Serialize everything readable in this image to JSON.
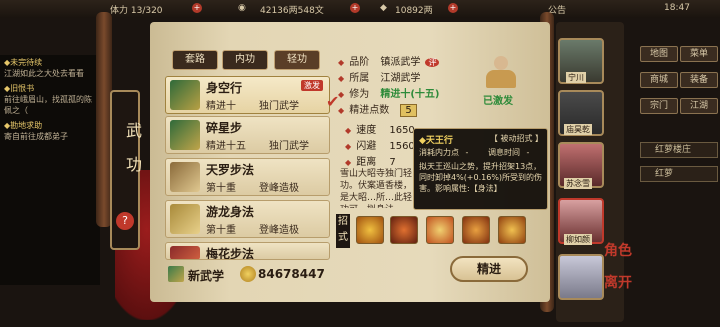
{
  "topbar": {
    "stamina": "13/320",
    "coins": "42136两548文",
    "silver": "10892两",
    "announcement": "公告",
    "time": "18:47"
  },
  "quests": [
    {
      "title": "◆未完待续",
      "desc": "江湖如此之大处去看看"
    },
    {
      "title": "◆旧恨书",
      "desc": "前往峨眉山，找孤孤的陈佩之（"
    },
    {
      "title": "◆勘地求助",
      "desc": "寄自前往成都弟子"
    }
  ],
  "side_title": "武功",
  "tabs": [
    "套路",
    "内功",
    "轻功"
  ],
  "skills": [
    {
      "name": "身空行",
      "level": "精进十",
      "type": "独门武学",
      "tag": "激发",
      "selected": true
    },
    {
      "name": "碎星步",
      "level": "精进十五",
      "type": "独门武学",
      "tag": "",
      "selected": false
    },
    {
      "name": "天罗步法",
      "level": "第十重",
      "type": "登峰造极",
      "tag": "",
      "selected": false
    },
    {
      "name": "游龙身法",
      "level": "第十重",
      "type": "登峰造极",
      "tag": "",
      "selected": false
    },
    {
      "name": "梅花步法",
      "level": "",
      "type": "",
      "tag": "",
      "selected": false
    }
  ],
  "new_skill": "新武学",
  "points": "84678447",
  "info": {
    "grade_label": "品阶",
    "grade_value": "镇派武学",
    "belong_label": "所属",
    "belong_value": "江湖武学",
    "cultivate_label": "修为",
    "cultivate_value": "精进十(十五)",
    "points_label": "精进点数",
    "points_value": "5",
    "activated": "已激发"
  },
  "stats": [
    {
      "label": "速度",
      "value": "1650"
    },
    {
      "label": "闪避",
      "value": "1560"
    },
    {
      "label": "距离",
      "value": "7"
    }
  ],
  "desc_text": "雪山大昭寺独门轻功。伏案遁香楼，是大昭…所…此轻功可…拟身法…",
  "tooltip": {
    "title": "◆天王行",
    "tag": "【 被动招式 】",
    "cost_label": "消耗内力点",
    "cost_value": "-",
    "cd_label": "调息时间",
    "cd_value": "-",
    "body": "拟天王巡山之势，提升招架13点，同时卸掉4%(+0.16%)所受到的伤害。影响属性:【身法】"
  },
  "moves_label": "招式",
  "practice": "精进",
  "right_buttons": [
    "地图",
    "菜单",
    "商城",
    "装备",
    "宗门",
    "江湖"
  ],
  "right_tags": [
    "红萝楼庄",
    "红萝"
  ],
  "chars": [
    {
      "name": "宁川"
    },
    {
      "name": "庙昊乾"
    },
    {
      "name": "苏念雪"
    },
    {
      "name": "柳如颜"
    },
    {
      "name": ""
    }
  ],
  "tool_bottom": [
    "角色",
    "离开"
  ],
  "colors": {
    "accent_red": "#c0392b",
    "paper": "#e3d6b4",
    "green": "#2e8b3a"
  }
}
